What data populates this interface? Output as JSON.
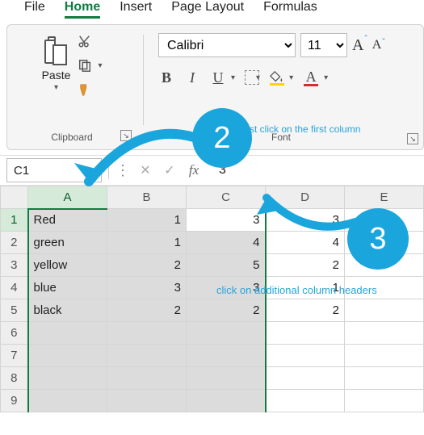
{
  "menu": {
    "items": [
      "File",
      "Home",
      "Insert",
      "Page Layout",
      "Formulas"
    ],
    "active": "Home"
  },
  "ribbon": {
    "clipboard": {
      "paste_label": "Paste",
      "group_label": "Clipboard"
    },
    "font": {
      "name": "Calibri",
      "size": "11",
      "bold": "B",
      "italic": "I",
      "underline": "U",
      "group_label": "Font",
      "highlight_color": "#ffd400",
      "font_color": "#d32f2f"
    }
  },
  "namebox": "C1",
  "formula_value": "3",
  "columns": [
    "A",
    "B",
    "C",
    "D",
    "E"
  ],
  "row_headers": [
    "1",
    "2",
    "3",
    "4",
    "5",
    "6",
    "7",
    "8",
    "9"
  ],
  "cells": {
    "r1": {
      "A": "Red",
      "B": "1",
      "C": "3",
      "D": "3",
      "E": ""
    },
    "r2": {
      "A": "green",
      "B": "1",
      "C": "4",
      "D": "4",
      "E": ""
    },
    "r3": {
      "A": "yellow",
      "B": "2",
      "C": "5",
      "D": "2",
      "E": ""
    },
    "r4": {
      "A": "blue",
      "B": "3",
      "C": "3",
      "D": "1",
      "E": ""
    },
    "r5": {
      "A": "black",
      "B": "2",
      "C": "2",
      "D": "2",
      "E": ""
    }
  },
  "annotations": {
    "step2_badge": "2",
    "step3_badge": "3",
    "step2_text": "first click on the first column",
    "step3_text": "click on additional column headers"
  }
}
